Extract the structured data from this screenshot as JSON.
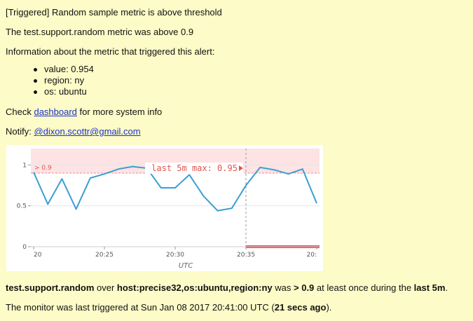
{
  "email": {
    "subject": "[Triggered] Random sample metric is above threshold",
    "summary": "The test.support.random metric was above 0.9",
    "info_heading": "Information about the metric that triggered this alert:",
    "metric_items": [
      "value: 0.954",
      "region: ny",
      "os: ubuntu"
    ],
    "check_prefix": "Check ",
    "dashboard_link": "dashboard",
    "check_suffix": " for more system info",
    "notify_prefix": "Notify: ",
    "notify_link": "@dixon.scottr@gmail.com",
    "status": {
      "metric": "test.support.random",
      "over": " over ",
      "host": "host:precise32,os:ubuntu,region:ny",
      "was": " was ",
      "cond": "> 0.9",
      "mid": " at least once during the ",
      "window": "last 5m",
      "end": "."
    },
    "last_triggered": {
      "prefix": "The monitor was last triggered at Sun Jan 08 2017 20:41:00 UTC (",
      "ago": "21 secs ago",
      "suffix": ")."
    }
  },
  "chart_data": {
    "type": "line",
    "x_label": "UTC",
    "x_ticks": [
      "20",
      "20:25",
      "20:30",
      "20:35",
      "20:"
    ],
    "x_tick_minutes": [
      20,
      25,
      30,
      35,
      40
    ],
    "xlim": [
      19.8,
      40.2
    ],
    "y_ticks": [
      "0",
      "0.5",
      "1"
    ],
    "y_tick_values": [
      0,
      0.5,
      1
    ],
    "ylim": [
      0,
      1.2
    ],
    "threshold": 0.9,
    "threshold_label": "> 0.9",
    "window_start_minute": 35,
    "max_annotation": "last 5m max: 0.95",
    "series_color": "#3a9fd1",
    "threshold_color": "#f7b9bd",
    "alert_color": "#e35757",
    "series": [
      {
        "x": [
          20,
          21,
          22,
          23,
          24,
          25,
          26,
          27,
          28,
          29,
          30,
          31,
          32,
          33,
          34,
          35,
          36,
          37,
          38,
          39,
          40
        ],
        "values": [
          0.91,
          0.52,
          0.83,
          0.46,
          0.84,
          0.89,
          0.95,
          0.98,
          0.96,
          0.72,
          0.72,
          0.88,
          0.62,
          0.44,
          0.47,
          0.75,
          0.97,
          0.94,
          0.89,
          0.95,
          0.53
        ]
      }
    ]
  }
}
